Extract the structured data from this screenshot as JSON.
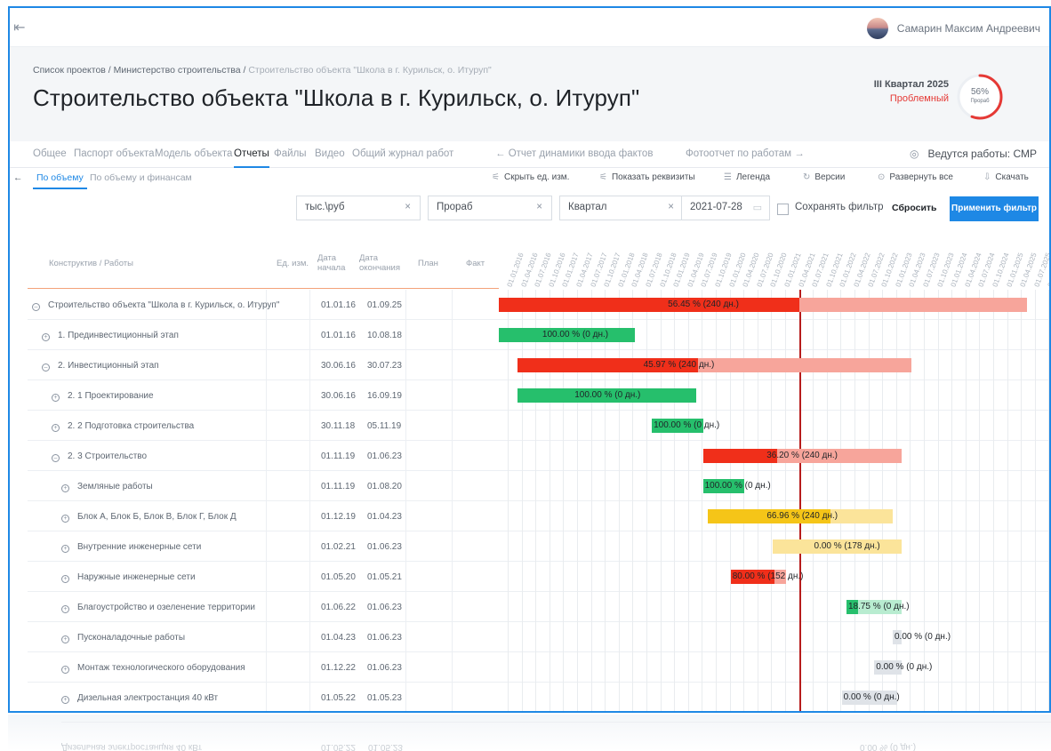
{
  "topbar": {
    "user_name": "Самарин Максим Андреевич"
  },
  "header": {
    "breadcrumb": [
      "Список проектов",
      "Министерство строительства"
    ],
    "breadcrumb_current": "Строительство объекта \"Школа в г. Курильск, о. Итуруп\"",
    "title": "Строительство объекта \"Школа в г. Курильск, о. Итуруп\"",
    "quarter": "III Квартал 2025",
    "status": "Проблемный",
    "progress_pct": "56%",
    "progress_value": 0.56,
    "progress_role": "Прораб",
    "colors": {
      "accent": "#1e88e5",
      "problem": "#e53935"
    }
  },
  "tabs": [
    "Общее",
    "Паспорт объекта",
    "Модель объекта",
    "Отчеты",
    "Файлы",
    "Видео",
    "Общий журнал работ"
  ],
  "active_tab": "Отчеты",
  "nav_prev": "← Отчет динамики ввода фактов",
  "nav_next": "Фотоотчет по работам →",
  "work_status": "Ведутся работы: СМР",
  "subtabs": [
    "По объему",
    "По объему и финансам"
  ],
  "tools": {
    "hide_units": "Скрыть ед. изм.",
    "show_props": "Показать реквизиты",
    "legend": "Легенда",
    "versions": "Версии",
    "expand_all": "Развернуть все",
    "download": "Скачать"
  },
  "filters": {
    "unit": "тыс.\\руб",
    "role": "Прораб",
    "period": "Квартал",
    "date": "2021-07-28",
    "save_filter": "Сохранять фильтр",
    "reset": "Сбросить",
    "apply": "Применить фильтр"
  },
  "columns": {
    "name": "Конструктив / Работы",
    "unit": "Ед. изм.",
    "start": "Дата начала",
    "end": "Дата окончания",
    "plan": "План",
    "fact": "Факт"
  },
  "timeline_ticks": [
    "01.01.2016",
    "01.04.2016",
    "01.07.2016",
    "01.10.2016",
    "01.01.2017",
    "01.04.2017",
    "01.07.2017",
    "01.10.2017",
    "01.01.2018",
    "01.04.2018",
    "01.07.2018",
    "01.10.2018",
    "01.01.2019",
    "01.04.2019",
    "01.07.2019",
    "01.10.2019",
    "01.01.2020",
    "01.04.2020",
    "01.07.2020",
    "01.10.2020",
    "01.01.2021",
    "01.04.2021",
    "01.07.2021",
    "01.10.2021",
    "01.01.2022",
    "01.04.2022",
    "01.07.2022",
    "01.10.2022",
    "01.01.2023",
    "01.04.2023",
    "01.07.2023",
    "01.10.2023",
    "01.01.2024",
    "01.04.2024",
    "01.07.2024",
    "01.10.2024",
    "01.01.2025",
    "01.04.2025",
    "01.07.2025",
    "01.10.2025"
  ],
  "timeline": {
    "start": "2016-01-01",
    "end": "2025-12-31",
    "today": "2021-07-28"
  },
  "rows": [
    {
      "name": "Строительство объекта \"Школа в г. Курильск, о. Итуруп\"",
      "level": 0,
      "expanded": true,
      "start": "01.01.16",
      "end": "01.09.25",
      "label": "56.45 % (240 дн.)",
      "plan_from": "2016-01-01",
      "plan_to": "2025-09-01",
      "fact_to": "2021-07-28",
      "color": "red"
    },
    {
      "name": "1. Прединвестиционный этап",
      "level": 1,
      "expanded": false,
      "start": "01.01.16",
      "end": "10.08.18",
      "label": "100.00 % (0 дн.)",
      "plan_from": "2016-01-01",
      "plan_to": "2018-08-10",
      "fact_to": "2018-08-10",
      "color": "green"
    },
    {
      "name": "2. Инвестиционный этап",
      "level": 1,
      "expanded": true,
      "start": "30.06.16",
      "end": "30.07.23",
      "label": "45.97 % (240 дн.)",
      "plan_from": "2016-06-30",
      "plan_to": "2023-07-30",
      "fact_to": "2019-10-01",
      "color": "red"
    },
    {
      "name": "2. 1 Проектирование",
      "level": 2,
      "expanded": false,
      "start": "30.06.16",
      "end": "16.09.19",
      "label": "100.00 % (0 дн.)",
      "plan_from": "2016-06-30",
      "plan_to": "2019-09-16",
      "fact_to": "2019-09-16",
      "color": "green"
    },
    {
      "name": "2. 2 Подготовка строительства",
      "level": 2,
      "expanded": false,
      "start": "30.11.18",
      "end": "05.11.19",
      "label": "100.00 % (0 дн.)",
      "plan_from": "2018-11-30",
      "plan_to": "2019-11-05",
      "fact_to": "2019-11-05",
      "color": "green"
    },
    {
      "name": "2. 3 Строительство",
      "level": 2,
      "expanded": true,
      "start": "01.11.19",
      "end": "01.06.23",
      "label": "36.20 % (240 дн.)",
      "plan_from": "2019-11-01",
      "plan_to": "2023-06-01",
      "fact_to": "2021-03-01",
      "color": "red"
    },
    {
      "name": "Земляные работы",
      "level": 3,
      "expanded": false,
      "start": "01.11.19",
      "end": "01.08.20",
      "label": "100.00 % (0 дн.)",
      "plan_from": "2019-11-01",
      "plan_to": "2020-08-01",
      "fact_to": "2020-08-01",
      "color": "green"
    },
    {
      "name": "Блок А, Блок Б, Блок В, Блок Г, Блок Д",
      "level": 3,
      "expanded": false,
      "start": "01.12.19",
      "end": "01.04.23",
      "label": "66.96 % (240 дн.)",
      "plan_from": "2019-12-01",
      "plan_to": "2023-04-01",
      "fact_to": "2022-02-15",
      "color": "yellow"
    },
    {
      "name": "Внутренние инженерные сети",
      "level": 3,
      "expanded": false,
      "start": "01.02.21",
      "end": "01.06.23",
      "label": "0.00 % (178 дн.)",
      "plan_from": "2021-02-01",
      "plan_to": "2023-06-01",
      "fact_to": "2021-02-01",
      "color": "yellow"
    },
    {
      "name": "Наружные инженерные сети",
      "level": 3,
      "expanded": false,
      "start": "01.05.20",
      "end": "01.05.21",
      "label": "80.00 % (152 дн.)",
      "plan_from": "2020-05-01",
      "plan_to": "2021-05-01",
      "fact_to": "2021-02-15",
      "color": "red"
    },
    {
      "name": "Благоустройство и озеленение территории",
      "level": 3,
      "expanded": false,
      "start": "01.06.22",
      "end": "01.06.23",
      "label": "18.75 % (0 дн.)",
      "plan_from": "2022-06-01",
      "plan_to": "2023-06-01",
      "fact_to": "2022-08-15",
      "color": "green"
    },
    {
      "name": "Пусконаладочные работы",
      "level": 3,
      "expanded": false,
      "start": "01.04.23",
      "end": "01.06.23",
      "label": "0.00 % (0 дн.)",
      "plan_from": "2023-04-01",
      "plan_to": "2023-06-01",
      "fact_to": "2023-04-01",
      "color": "grey"
    },
    {
      "name": "Монтаж технологического оборудования",
      "level": 3,
      "expanded": false,
      "start": "01.12.22",
      "end": "01.06.23",
      "label": "0.00 % (0 дн.)",
      "plan_from": "2022-12-01",
      "plan_to": "2023-06-01",
      "fact_to": "2022-12-01",
      "color": "grey"
    },
    {
      "name": "Дизельная электростанция 40 кВт",
      "level": 3,
      "expanded": false,
      "start": "01.05.22",
      "end": "01.05.23",
      "label": "0.00 % (0 дн.)",
      "plan_from": "2022-05-01",
      "plan_to": "2023-05-01",
      "fact_to": "2022-05-01",
      "color": "grey"
    }
  ],
  "palette": {
    "red": [
      "#f02f1a",
      "#f7a59b"
    ],
    "green": [
      "#26bf6c",
      "#b8ecd0"
    ],
    "yellow": [
      "#f5c518",
      "#fbe49a"
    ],
    "grey": [
      "#c9ced6",
      "#dfe3e8"
    ]
  }
}
